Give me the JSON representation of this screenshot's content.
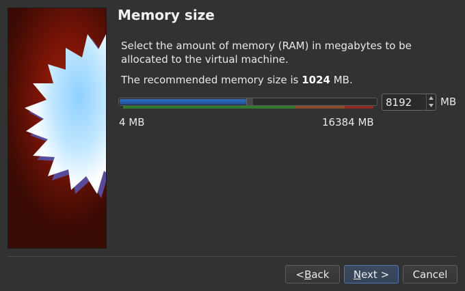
{
  "header": {
    "title": "Memory size"
  },
  "content": {
    "description": "Select the amount of memory (RAM) in megabytes to be allocated to the virtual machine.",
    "recommended_prefix": "The recommended memory size is ",
    "recommended_value": "1024",
    "recommended_suffix": " MB."
  },
  "memory": {
    "min_label": "4 MB",
    "max_label": "16384 MB",
    "value": "8192",
    "unit": "MB",
    "slider_fraction": 0.5
  },
  "colors": {
    "slider_fill": "#2f6fc0",
    "zone_green": "#2f7a2f",
    "zone_orange": "#8a4a2a",
    "zone_red": "#8e2a22"
  },
  "buttons": {
    "back": {
      "prefix": "< ",
      "mnemonic": "B",
      "rest": "ack"
    },
    "next": {
      "mnemonic": "N",
      "rest": "ext >"
    },
    "cancel": "Cancel"
  }
}
